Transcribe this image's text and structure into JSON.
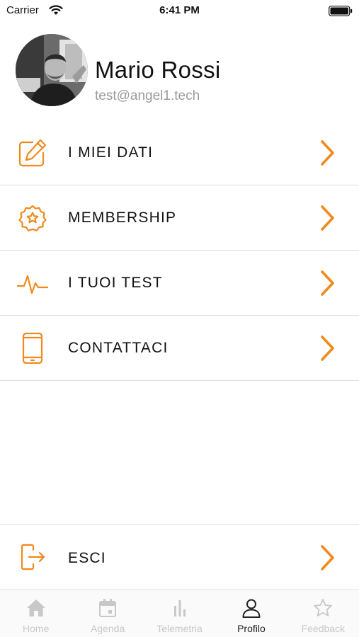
{
  "status_bar": {
    "carrier": "Carrier",
    "time": "6:41 PM"
  },
  "profile": {
    "name": "Mario Rossi",
    "email": "test@angel1.tech"
  },
  "menu": {
    "items": [
      {
        "label": "I MIEI DATI",
        "icon": "edit-icon"
      },
      {
        "label": "MEMBERSHIP",
        "icon": "badge-star-icon"
      },
      {
        "label": "I TUOI TEST",
        "icon": "pulse-icon"
      },
      {
        "label": "CONTATTACI",
        "icon": "smartphone-icon"
      }
    ],
    "logout": {
      "label": "ESCI",
      "icon": "logout-icon"
    }
  },
  "tabbar": {
    "tabs": [
      {
        "label": "Home",
        "icon": "home-icon",
        "active": false
      },
      {
        "label": "Agenda",
        "icon": "calendar-icon",
        "active": false
      },
      {
        "label": "Telemetria",
        "icon": "bar-chart-icon",
        "active": false
      },
      {
        "label": "Profilo",
        "icon": "user-icon",
        "active": true
      },
      {
        "label": "Feedback",
        "icon": "star-icon",
        "active": false
      }
    ]
  },
  "colors": {
    "accent": "#F08A1C",
    "inactive": "#C8C8C8",
    "divider": "#DCDCDC",
    "secondary_text": "#9A9A9A"
  }
}
